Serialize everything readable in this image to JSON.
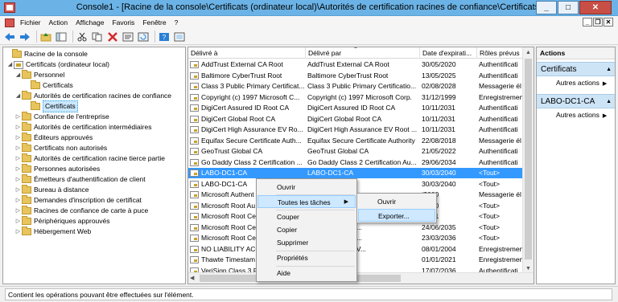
{
  "window": {
    "title": "Console1 - [Racine de la console\\Certificats (ordinateur local)\\Autorités de certification racines de confiance\\Certificats]",
    "min": "_",
    "max": "□",
    "close": "✕"
  },
  "menu": {
    "items": [
      "Fichier",
      "Action",
      "Affichage",
      "Favoris",
      "Fenêtre",
      "?"
    ],
    "mdi": [
      "_",
      "❐",
      "✕"
    ]
  },
  "toolbar": {
    "icons": [
      "back-arrow-icon",
      "forward-arrow-icon",
      "up-folder-icon",
      "show-tree-icon",
      "cut-icon",
      "copy-icon",
      "delete-icon",
      "properties-icon",
      "refresh-icon",
      "help-icon",
      "export-list-icon"
    ]
  },
  "tree": {
    "items": [
      {
        "label": "Racine de la console",
        "level": 0,
        "arrow": "",
        "icon": "folder"
      },
      {
        "label": "Certificats (ordinateur local)",
        "level": 1,
        "arrow": "◢",
        "icon": "cert"
      },
      {
        "label": "Personnel",
        "level": 2,
        "arrow": "◢",
        "icon": "folder"
      },
      {
        "label": "Certificats",
        "level": 3,
        "arrow": "",
        "icon": "folder"
      },
      {
        "label": "Autorités de certification racines de confiance",
        "level": 2,
        "arrow": "◢",
        "icon": "folder"
      },
      {
        "label": "Certificats",
        "level": 3,
        "arrow": "",
        "icon": "folder",
        "selected": true
      },
      {
        "label": "Confiance de l'entreprise",
        "level": 2,
        "arrow": "▷",
        "icon": "folder"
      },
      {
        "label": "Autorités de certification intermédiaires",
        "level": 2,
        "arrow": "▷",
        "icon": "folder"
      },
      {
        "label": "Éditeurs approuvés",
        "level": 2,
        "arrow": "▷",
        "icon": "folder"
      },
      {
        "label": "Certificats non autorisés",
        "level": 2,
        "arrow": "▷",
        "icon": "folder"
      },
      {
        "label": "Autorités de certification racine tierce partie",
        "level": 2,
        "arrow": "▷",
        "icon": "folder"
      },
      {
        "label": "Personnes autorisées",
        "level": 2,
        "arrow": "▷",
        "icon": "folder"
      },
      {
        "label": "Émetteurs d'authentification de client",
        "level": 2,
        "arrow": "▷",
        "icon": "folder"
      },
      {
        "label": "Bureau à distance",
        "level": 2,
        "arrow": "▷",
        "icon": "folder"
      },
      {
        "label": "Demandes d'inscription de certificat",
        "level": 2,
        "arrow": "▷",
        "icon": "folder"
      },
      {
        "label": "Racines de confiance de carte à puce",
        "level": 2,
        "arrow": "▷",
        "icon": "folder"
      },
      {
        "label": "Périphériques approuvés",
        "level": 2,
        "arrow": "▷",
        "icon": "folder"
      },
      {
        "label": "Hébergement Web",
        "level": 2,
        "arrow": "▷",
        "icon": "folder"
      }
    ]
  },
  "list": {
    "columns": [
      "Délivré à",
      "Délivré par",
      "Date d'expirati...",
      "Rôles prévus"
    ],
    "sort_indicator": "▲",
    "rows": [
      [
        "AddTrust External CA Root",
        "AddTrust External CA Root",
        "30/05/2020",
        "Authentificati"
      ],
      [
        "Baltimore CyberTrust Root",
        "Baltimore CyberTrust Root",
        "13/05/2025",
        "Authentificati"
      ],
      [
        "Class 3 Public Primary Certificat...",
        "Class 3 Public Primary Certificatio...",
        "02/08/2028",
        "Messagerie él"
      ],
      [
        "Copyright (c) 1997 Microsoft C...",
        "Copyright (c) 1997 Microsoft Corp.",
        "31/12/1999",
        "Enregistremen"
      ],
      [
        "DigiCert Assured ID Root CA",
        "DigiCert Assured ID Root CA",
        "10/11/2031",
        "Authentificati"
      ],
      [
        "DigiCert Global Root CA",
        "DigiCert Global Root CA",
        "10/11/2031",
        "Authentificati"
      ],
      [
        "DigiCert High Assurance EV Ro...",
        "DigiCert High Assurance EV Root ...",
        "10/11/2031",
        "Authentificati"
      ],
      [
        "Equifax Secure Certificate Auth...",
        "Equifax Secure Certificate Authority",
        "22/08/2018",
        "Messagerie él"
      ],
      [
        "GeoTrust Global CA",
        "GeoTrust Global CA",
        "21/05/2022",
        "Authentificati"
      ],
      [
        "Go Daddy Class 2 Certification ...",
        "Go Daddy Class 2 Certification Au...",
        "29/06/2034",
        "Authentificati"
      ],
      [
        "LABO-DC1-CA",
        "LABO-DC1-CA",
        "30/03/2040",
        "<Tout>"
      ],
      [
        "LABO-DC1-CA",
        "",
        "30/03/2040",
        "<Tout>"
      ],
      [
        "Microsoft Authent",
        "",
        "/2000",
        "Messagerie él"
      ],
      [
        "Microsoft Root Au",
        "",
        "/2020",
        "<Tout>"
      ],
      [
        "Microsoft Root Ce",
        "",
        "/2021",
        "<Tout>"
      ],
      [
        "Microsoft Root Ce",
        "ertificate Authori...",
        "24/06/2035",
        "<Tout>"
      ],
      [
        "Microsoft Root Ce",
        "ertificate Authori...",
        "23/03/2036",
        "<Tout>"
      ],
      [
        "NO LIABILITY ACC",
        "CEPTED, (c)97 V...",
        "08/01/2004",
        "Enregistremen"
      ],
      [
        "Thawte Timestam",
        "mping CA",
        "01/01/2021",
        "Enregistremen"
      ],
      [
        "VeriSign Class 3 P",
        "ublic Primary Ce...",
        "17/07/2036",
        "Authentificati"
      ]
    ],
    "selected_index": 10
  },
  "actions": {
    "title": "Actions",
    "sections": [
      {
        "title": "Certificats",
        "item": "Autres actions",
        "arrow": "▶"
      },
      {
        "title": "LABO-DC1-CA",
        "item": "Autres actions",
        "arrow": "▶"
      }
    ],
    "collapse": "▲"
  },
  "context_menu": {
    "items": [
      "Ouvrir",
      "Toutes les tâches",
      "Couper",
      "Copier",
      "Supprimer",
      "Propriétés",
      "Aide"
    ],
    "submenu_arrow": "▶",
    "submenu": [
      "Ouvrir",
      "Exporter..."
    ]
  },
  "status": {
    "text": "Contient les opérations pouvant être effectuées sur l'élément."
  },
  "colors": {
    "selection": "#3399ff",
    "titlebar": "#6bb3e6",
    "menu_highlight": "#cde8ff"
  }
}
